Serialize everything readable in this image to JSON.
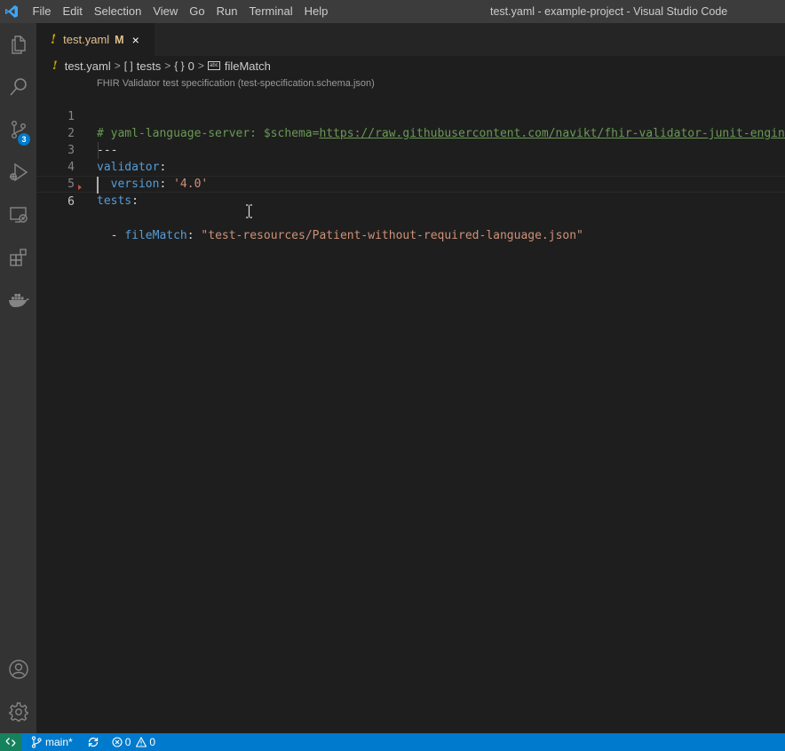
{
  "window": {
    "title": "test.yaml - example-project - Visual Studio Code",
    "menu": [
      "File",
      "Edit",
      "Selection",
      "View",
      "Go",
      "Run",
      "Terminal",
      "Help"
    ]
  },
  "activity_bar": {
    "items": [
      {
        "icon": "files-icon"
      },
      {
        "icon": "search-icon"
      },
      {
        "icon": "source-control-icon",
        "badge": "3"
      },
      {
        "icon": "run-debug-icon"
      },
      {
        "icon": "remote-explorer-icon"
      },
      {
        "icon": "extensions-icon"
      },
      {
        "icon": "docker-icon"
      }
    ],
    "bottom": [
      {
        "icon": "accounts-icon"
      },
      {
        "icon": "settings-gear-icon"
      }
    ]
  },
  "tabs": [
    {
      "warn": "!",
      "name": "test.yaml",
      "status": "M",
      "close": "×"
    }
  ],
  "breadcrumbs": {
    "file": "test.yaml",
    "items": [
      "tests",
      "0",
      "fileMatch"
    ],
    "array_icon": "[ ]",
    "object_icon": "{ }",
    "string_icon": "abc"
  },
  "codelens": "FHIR Validator test specification (test-specification.schema.json)",
  "editor": {
    "line_numbers": [
      "1",
      "2",
      "3",
      "4",
      "5",
      "6"
    ],
    "lines": {
      "l1_comment": "# yaml-language-server: $schema=",
      "l1_url": "https://raw.githubusercontent.com/navikt/fhir-validator-junit-engine/",
      "l2": "---",
      "l3_key": "validator",
      "l3_colon": ":",
      "l4_indent": "  ",
      "l4_key": "version",
      "l4_colon": ": ",
      "l4_value": "'4.0'",
      "l5_key": "tests",
      "l5_colon": ":",
      "l6_dash": "  - ",
      "l6_key": "fileMatch",
      "l6_colon": ": ",
      "l6_value": "\"test-resources/Patient-without-required-language.json\""
    }
  },
  "status_bar": {
    "branch": "main*",
    "errors": "0",
    "warnings": "0"
  },
  "colors": {
    "accent": "#007acc",
    "remote": "#16825d",
    "warning": "#cca700",
    "modified": "#e2c08d"
  }
}
